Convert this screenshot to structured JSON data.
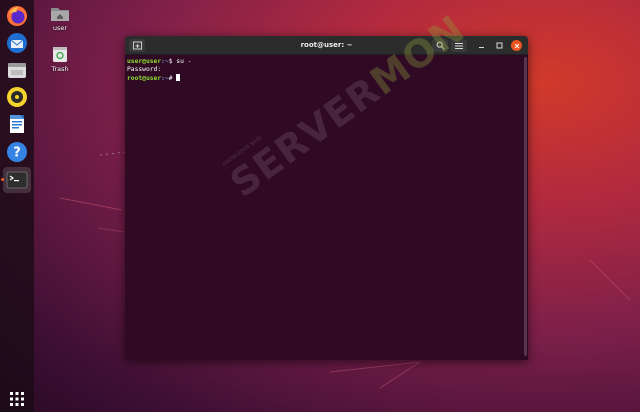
{
  "desktop": {
    "icons": [
      {
        "label": "user",
        "icon": "home-folder-icon"
      },
      {
        "label": "Trash",
        "icon": "trash-icon"
      }
    ]
  },
  "dock": {
    "items": [
      {
        "name": "firefox",
        "icon": "firefox-icon"
      },
      {
        "name": "thunderbird",
        "icon": "thunderbird-icon"
      },
      {
        "name": "files",
        "icon": "files-icon"
      },
      {
        "name": "rhythmbox",
        "icon": "rhythmbox-icon"
      },
      {
        "name": "writer",
        "icon": "libreoffice-writer-icon"
      },
      {
        "name": "help",
        "icon": "help-icon"
      },
      {
        "name": "terminal",
        "icon": "terminal-icon",
        "active": true
      }
    ],
    "app_grid": "show-applications-icon"
  },
  "terminal": {
    "title": "root@user: ~",
    "lines": [
      {
        "prompt_user": "user@user",
        "prompt_path": ":~",
        "prompt_sym": "$",
        "command": " su -"
      },
      {
        "output": "Password:"
      },
      {
        "prompt_user": "root@user",
        "prompt_path": ":~",
        "prompt_sym": "#",
        "command": " "
      }
    ]
  },
  "watermark": {
    "small_text": "KNOWLEDGE BASE",
    "main_left": "SERVER",
    "main_right": "MON"
  },
  "colors": {
    "terminal_bg": "#300a24",
    "prompt_user": "#8ae234",
    "prompt_path": "#729fcf",
    "accent": "#e95420"
  }
}
